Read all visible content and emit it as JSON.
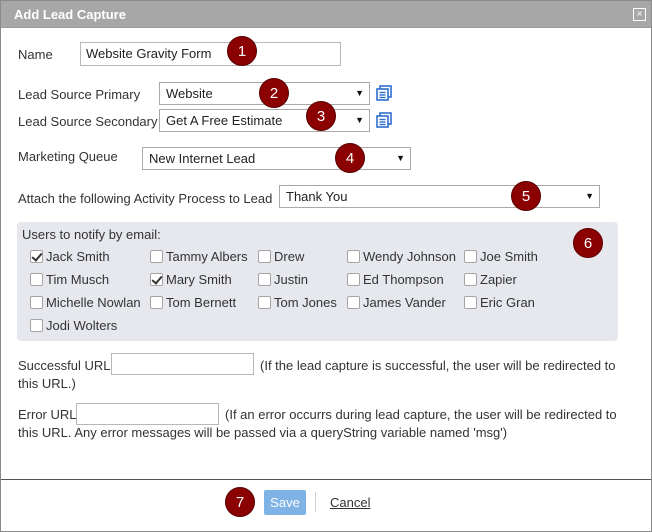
{
  "dialog": {
    "title": "Add Lead Capture",
    "close_glyph": "×"
  },
  "form": {
    "name_label": "Name",
    "name_value": "Website Gravity Form",
    "lead_source_primary_label": "Lead Source Primary",
    "lead_source_primary_value": "Website",
    "lead_source_secondary_label": "Lead Source Secondary",
    "lead_source_secondary_value": "Get A Free Estimate",
    "marketing_queue_label": "Marketing Queue",
    "marketing_queue_value": "New Internet Lead",
    "activity_process_label": "Attach the following Activity Process to Lead",
    "activity_process_value": "Thank You",
    "dropdown_arrow": "▼"
  },
  "notify": {
    "heading": "Users to notify by email:",
    "users": [
      {
        "name": "Jack Smith",
        "checked": true
      },
      {
        "name": "Tammy Albers",
        "checked": false
      },
      {
        "name": "Drew",
        "checked": false
      },
      {
        "name": "Wendy Johnson",
        "checked": false
      },
      {
        "name": "Joe Smith",
        "checked": false
      },
      {
        "name": "Tim Musch",
        "checked": false
      },
      {
        "name": "Mary Smith",
        "checked": true
      },
      {
        "name": "Justin",
        "checked": false
      },
      {
        "name": "Ed Thompson",
        "checked": false
      },
      {
        "name": "Zapier",
        "checked": false
      },
      {
        "name": "Michelle Nowlan",
        "checked": false
      },
      {
        "name": "Tom Bernett",
        "checked": false
      },
      {
        "name": "Tom Jones",
        "checked": false
      },
      {
        "name": "James Vander",
        "checked": false
      },
      {
        "name": "Eric Gran",
        "checked": false
      },
      {
        "name": "Jodi Wolters",
        "checked": false
      }
    ]
  },
  "urls": {
    "success_label": "Successful URL",
    "success_value": "",
    "success_help_1": "(If the lead capture is successful, the user will be redirected to",
    "success_help_2": "this URL.)",
    "error_label": "Error URL",
    "error_value": "",
    "error_help_1": "(If an error occurrs during lead capture, the user will be redirected to",
    "error_help_2": "this URL. Any error messages will be passed via a queryString variable named 'msg')"
  },
  "actions": {
    "save_label": "Save",
    "cancel_label": "Cancel"
  },
  "badges": [
    "1",
    "2",
    "3",
    "4",
    "5",
    "6",
    "7"
  ],
  "colors": {
    "titlebar": "#a7a7a7",
    "badge": "#8b0000",
    "save_button": "#7fb2e5",
    "panel": "#e6e8ee",
    "list_icon": "#2f6fcf"
  },
  "icons": {
    "list": "list-icon",
    "close": "close-icon",
    "dropdown": "chevron-down-icon"
  }
}
